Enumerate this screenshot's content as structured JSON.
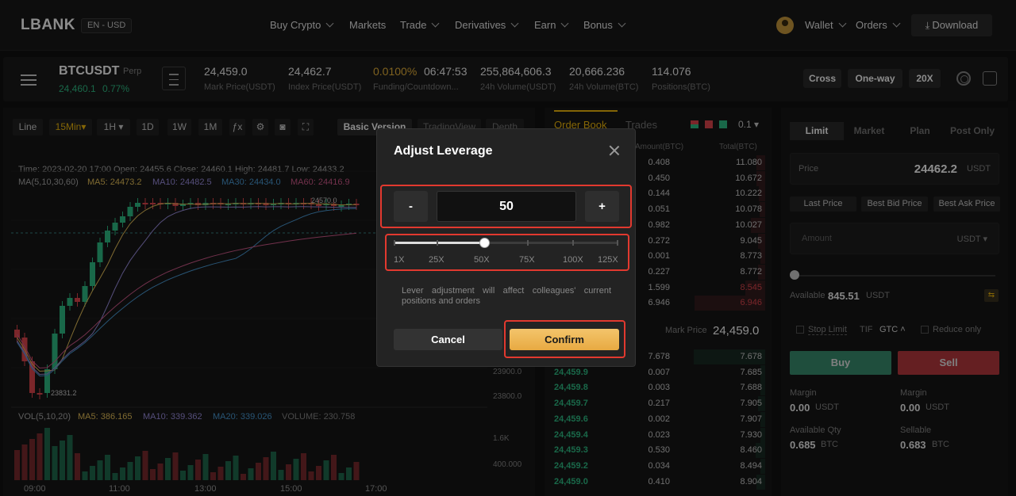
{
  "nav": {
    "logo": "LBANK",
    "lang": "EN - USD",
    "items": [
      "Buy Crypto",
      "Markets",
      "Trade",
      "Derivatives",
      "Earn",
      "Bonus"
    ],
    "wallet": "Wallet",
    "orders": "Orders",
    "download": "Download"
  },
  "ticker": {
    "symbol": "BTCUSDT",
    "type": "Perp",
    "last_price": "24,460.1",
    "change": "0.77%",
    "stats": [
      {
        "value": "24,459.0",
        "label": "Mark Price(USDT)"
      },
      {
        "value": "24,462.7",
        "label": "Index Price(USDT)"
      },
      {
        "value": "0.0100%",
        "value2": "06:47:53",
        "label": "Funding/Countdown..."
      },
      {
        "value": "255,864,606.3",
        "label": "24h Volume(USDT)"
      },
      {
        "value": "20,666.236",
        "label": "24h Volume(BTC)"
      },
      {
        "value": "114.076",
        "label": "Positions(BTC)"
      }
    ],
    "margin_mode": "Cross",
    "position_mode": "One-way",
    "leverage": "20X"
  },
  "chart": {
    "toolbar": [
      "Line",
      "15Min▾",
      "1H ▾",
      "1D",
      "1W",
      "1M"
    ],
    "views": [
      "Basic Version",
      "TradingView",
      "Depth"
    ],
    "info_line": "Time: 2023-02-20 17:00   Open: 24455.6   Close: 24460.1   High: 24481.7   Low: 24433.2",
    "ma_label": "MA(5,10,30,60)",
    "ma5": "MA5: 24473.2",
    "ma10": "MA10: 24482.5",
    "ma30": "MA30: 24434.0",
    "ma60": "MA60: 24416.9",
    "high_marker": "24570.0",
    "low_marker": "23831.2",
    "y_labels": [
      "23900.0",
      "23800.0",
      "1.6K",
      "400.000"
    ],
    "vol_label": "VOL(5,10,20)",
    "vol_ma5": "MA5: 386.165",
    "vol_ma10": "MA10: 339.362",
    "vol_ma20": "MA20: 339.026",
    "vol_volume": "VOLUME: 230.758",
    "x_labels": [
      "09:00",
      "11:00",
      "13:00",
      "15:00",
      "17:00"
    ],
    "colors": {
      "up": "#2fbd85",
      "down": "#e0464e",
      "ma5": "#e8c25a",
      "ma10": "#9b8fe0",
      "ma30": "#4a9ad4",
      "ma60": "#d05a8a"
    }
  },
  "orderbook": {
    "tabs": [
      "Order Book",
      "Trades"
    ],
    "precision": "0.1",
    "col_amount": "Amount(BTC)",
    "col_total": "Total(BTC)",
    "asks": [
      {
        "q": "0.408",
        "t": "11.080"
      },
      {
        "q": "0.450",
        "t": "10.672"
      },
      {
        "q": "0.144",
        "t": "10.222"
      },
      {
        "q": "0.051",
        "t": "10.078"
      },
      {
        "q": "0.982",
        "t": "10.027"
      },
      {
        "q": "0.272",
        "t": "9.045"
      },
      {
        "q": "0.001",
        "t": "8.773"
      },
      {
        "q": "0.227",
        "t": "8.772"
      },
      {
        "q": "1.599",
        "t": "8.545"
      },
      {
        "q": "6.946",
        "t": "6.946"
      }
    ],
    "mark_label": "Mark Price",
    "mark_price": "24,459.0",
    "bids": [
      {
        "p": "",
        "q": "7.678",
        "t": "7.678"
      },
      {
        "p": "24,459.9",
        "q": "0.007",
        "t": "7.685"
      },
      {
        "p": "24,459.8",
        "q": "0.003",
        "t": "7.688"
      },
      {
        "p": "24,459.7",
        "q": "0.217",
        "t": "7.905"
      },
      {
        "p": "24,459.6",
        "q": "0.002",
        "t": "7.907"
      },
      {
        "p": "24,459.4",
        "q": "0.023",
        "t": "7.930"
      },
      {
        "p": "24,459.3",
        "q": "0.530",
        "t": "8.460"
      },
      {
        "p": "24,459.2",
        "q": "0.034",
        "t": "8.494"
      },
      {
        "p": "24,459.0",
        "q": "0.410",
        "t": "8.904"
      }
    ]
  },
  "trade": {
    "tabs": [
      "Limit",
      "Market",
      "Plan",
      "Post Only"
    ],
    "price_label": "Price",
    "price_value": "24462.2",
    "price_unit": "USDT",
    "quick": [
      "Last Price",
      "Best Bid Price",
      "Best Ask Price"
    ],
    "amount_placeholder": "Amount",
    "amount_unit": "USDT ▾",
    "available_label": "Available",
    "available_value": "845.51",
    "available_unit": "USDT",
    "stop_limit": "Stop Limit",
    "tif": "TIF",
    "tif_value": "GTC",
    "reduce_only": "Reduce only",
    "buy": "Buy",
    "sell": "Sell",
    "margin_label": "Margin",
    "margin_buy": "0.00",
    "margin_sell": "0.00",
    "margin_unit": "USDT",
    "avail_qty_label": "Available Qty",
    "avail_qty": "0.685",
    "sellable_label": "Sellable",
    "sellable": "0.683",
    "btc_unit": "BTC"
  },
  "modal": {
    "title": "Adjust Leverage",
    "minus": "-",
    "plus": "+",
    "value": "50",
    "slider_labels": [
      "1X",
      "25X",
      "50X",
      "75X",
      "100X",
      "125X"
    ],
    "slider_fraction": 0.4,
    "note": "Lever adjustment will affect colleagues' current positions and orders",
    "cancel": "Cancel",
    "confirm": "Confirm"
  }
}
